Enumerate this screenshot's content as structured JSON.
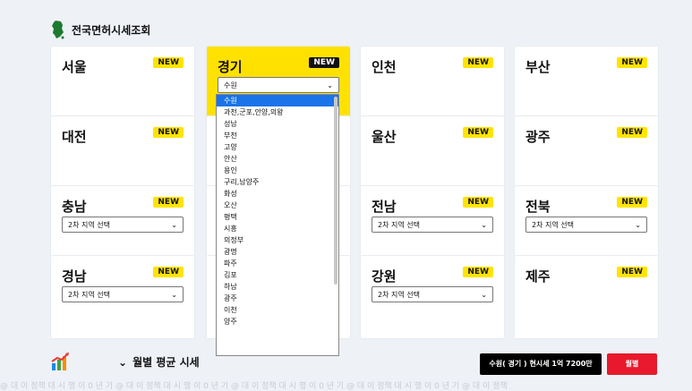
{
  "header": {
    "title": "전국면허시세조회",
    "icon": "korea-map-icon"
  },
  "cards": [
    {
      "name": "서울",
      "badge": "NEW"
    },
    {
      "name": "경기",
      "badge": "NEW",
      "select": "수원"
    },
    {
      "name": "인천",
      "badge": "NEW"
    },
    {
      "name": "부산",
      "badge": "NEW"
    },
    {
      "name": "대전",
      "badge": "NEW"
    },
    {
      "name": "울산",
      "badge": "NEW"
    },
    {
      "name": "광주",
      "badge": "NEW"
    },
    {
      "name": "충남",
      "badge": "NEW",
      "select": "2차 지역 선택"
    },
    {
      "name": "전남",
      "badge": "NEW",
      "select": "2차 지역 선택"
    },
    {
      "name": "전북",
      "badge": "NEW",
      "select": "2차 지역 선택"
    },
    {
      "name": "경남",
      "badge": "NEW",
      "select": "2차 지역 선택"
    },
    {
      "name": "강원",
      "badge": "NEW",
      "select": "2차 지역 선택"
    },
    {
      "name": "제주",
      "badge": "NEW"
    }
  ],
  "dropdown": {
    "options": [
      "수원",
      "과천,군포,안양,의왕",
      "성남",
      "부천",
      "고양",
      "안산",
      "용인",
      "구리,남양주",
      "화성",
      "오산",
      "평택",
      "시흥",
      "의정부",
      "광명",
      "파주",
      "김포",
      "하남",
      "광주",
      "이천",
      "양주"
    ]
  },
  "bottom": {
    "icon": "bar-chart-icon",
    "section_label": "월별 평균 시세",
    "price_button": "수원( 경기 ) 현시세 1억 7200만",
    "monthly_button": "월별"
  },
  "watermark": "@ 대 이 정책 대 시 행 이 0 년 기  @ 대 이 정책 대 시 행 이 0 년 기  @ 대 이 정책 대 시 행 이 0 년 기  @ 대 이 정책 대 시 행 이 0 년 기  @ 대 이 정책"
}
